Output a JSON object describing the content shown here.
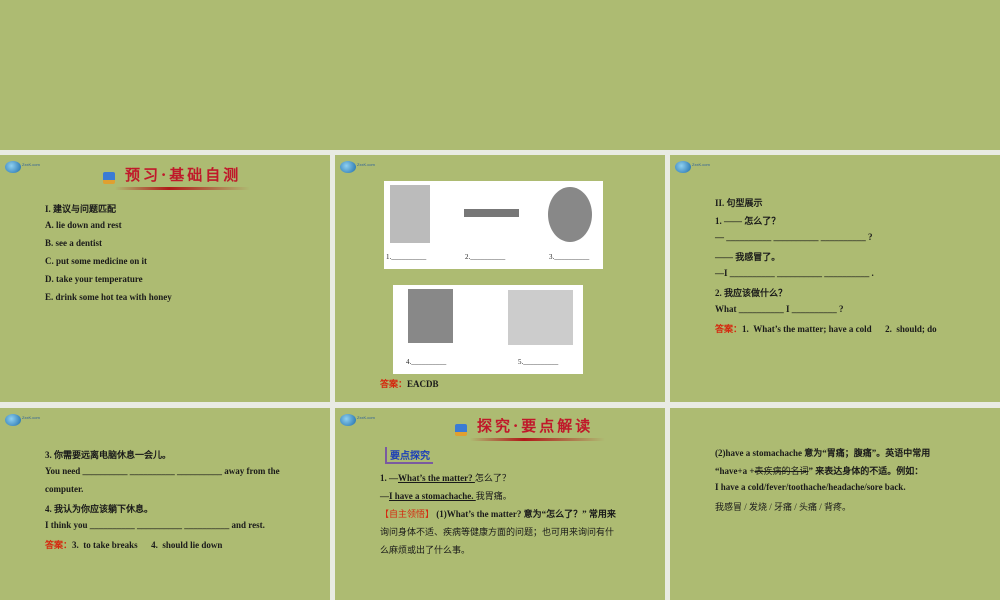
{
  "slide1": {
    "heading": "预习·基础自测",
    "lines": [
      "I.  建议与问题匹配",
      "A.  lie down and rest",
      "B.  see a dentist",
      "C.  put some medicine on it",
      "D.  take your temperature",
      "E.  drink some hot tea with honey"
    ]
  },
  "slide2": {
    "labels": [
      "1.__________",
      "2.__________",
      "3.__________",
      "4.__________",
      "5.__________"
    ],
    "answer_label": "答案：",
    "answer": "EACDB"
  },
  "slide3": {
    "lines": [
      "II.  句型展示",
      "1.  —— 怎么了？",
      "— __________ __________ __________ ?",
      "—— 我感冒了。",
      "—I __________ __________ __________ .",
      "2.  我应该做什么？",
      "What __________ I __________ ?"
    ],
    "answer_label": "答案：",
    "answer": "1.  What’s the matter; have a cold      2.  should; do"
  },
  "slide4": {
    "lines": [
      "3.  你需要远离电脑休息一会儿。",
      "You need __________ __________ __________ away from the",
      "computer.",
      "4.  我认为你应该躺下休息。",
      "I think you __________  __________  __________ and rest."
    ],
    "answer_label": "答案：",
    "answer": "3.  to take breaks      4.  should lie down"
  },
  "slide5": {
    "heading": "探究·要点解读",
    "badge": "要点探究",
    "l1a": "1.  —",
    "l1b": "What’s the matter? ",
    "l1c": " 怎么了？",
    "l2a": "—",
    "l2b": "I have a stomachache. ",
    "l2c": " 我胃痛。",
    "tag": "【自主领悟】",
    "l3": " (1)What’s the matter?  意为“怎么了？” 常用来",
    "l4": "询问身体不适、疾病等健康方面的问题；也可用来询问有什",
    "l5": "么麻烦或出了什么事。"
  },
  "slide6": {
    "l1": "(2)have a stomachache 意为“胃痛；腹痛”。英语中常用",
    "l2a": "“have+a +",
    "l2b": "表疾病的名词",
    "l2c": "” 来表达身体的不适。例如：",
    "l3": "I have a cold/fever/toothache/headache/sore back.",
    "l4": "我感冒 / 发烧 / 牙痛 / 头痛 / 背疼。"
  },
  "logo_text": "ZxxK.com"
}
